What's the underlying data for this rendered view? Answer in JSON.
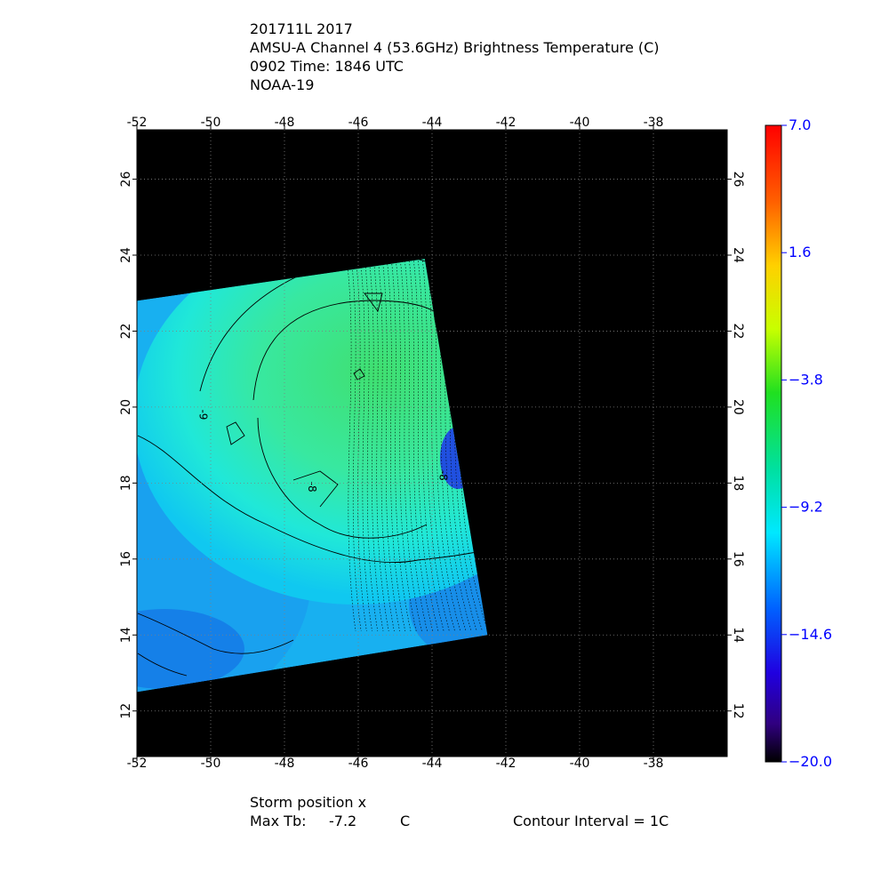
{
  "header": {
    "line1": "201711L 2017",
    "line2": "AMSU-A Channel 4 (53.6GHz) Brightness Temperature (C)",
    "line3": "0902 Time: 1846 UTC",
    "line4": "NOAA-19"
  },
  "footer": {
    "storm_position": "Storm position x",
    "max_tb_label": "Max Tb:",
    "max_tb_value": "-7.2",
    "max_tb_unit": "C",
    "contour_interval": "Contour Interval = 1C"
  },
  "colors": {
    "background_no_data": "#000000",
    "colorbar_label": "#0000ff"
  },
  "chart_data": {
    "type": "heatmap",
    "title": "AMSU-A Channel 4 (53.6GHz) Brightness Temperature (C)",
    "x_ticks": [
      -52,
      -50,
      -48,
      -46,
      -44,
      -42,
      -40,
      -38
    ],
    "x_tick_labels": [
      "-52",
      "-50",
      "-48",
      "-46",
      "-44",
      "-42",
      "-40",
      "-38"
    ],
    "xlim": [
      -52,
      -36
    ],
    "y_ticks": [
      12,
      14,
      16,
      18,
      20,
      22,
      24,
      26
    ],
    "y_tick_labels": [
      "12",
      "14",
      "16",
      "18",
      "20",
      "22",
      "24",
      "26"
    ],
    "ylim": [
      10.8,
      27.3
    ],
    "grid": true,
    "swath_corners": [
      [
        -52,
        22.8
      ],
      [
        -44.2,
        23.9
      ],
      [
        -42.5,
        14.0
      ],
      [
        -52,
        12.5
      ]
    ],
    "colorbar": {
      "min": -20.0,
      "max": 7.0,
      "tick_values": [
        7.0,
        1.6,
        -3.8,
        -9.2,
        -14.6,
        -20.0
      ],
      "tick_labels": [
        "7.0",
        "1.6",
        "−3.8",
        "−9.2",
        "−14.6",
        "−20.0"
      ]
    },
    "contour_labels": [
      {
        "text": "-9",
        "lon": -50.3,
        "lat": 19.8
      },
      {
        "text": "-8",
        "lon": -47.35,
        "lat": 17.9
      },
      {
        "text": "-8",
        "lon": -43.8,
        "lat": 18.2
      }
    ],
    "max_tb": -7.2,
    "contour_interval_c": 1
  }
}
